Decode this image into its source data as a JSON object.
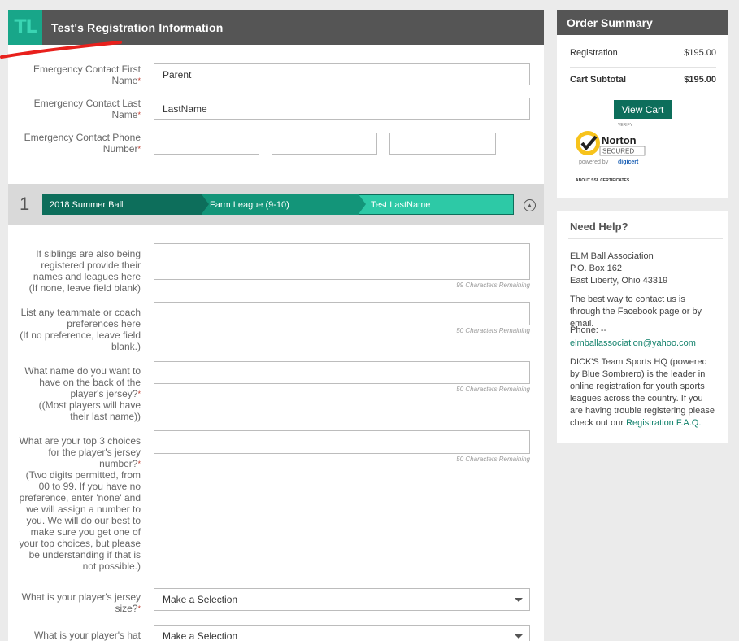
{
  "main": {
    "badge": "TL",
    "title": "Test's Registration Information"
  },
  "emergency": {
    "first_name_label": "Emergency Contact First Name",
    "first_name_value": "Parent",
    "last_name_label": "Emergency Contact Last Name",
    "last_name_value": "LastName",
    "phone_label": "Emergency Contact Phone Number"
  },
  "progress": {
    "number": "1",
    "steps": [
      "2018 Summer Ball",
      "Farm League (9-10)",
      "Test LastName"
    ]
  },
  "questions": {
    "siblings_label_1": "If siblings are also being registered provide their names and leagues here",
    "siblings_label_2": "(If none, leave field blank)",
    "siblings_chars": "99 Characters Remaining",
    "teammate_label_1": "List any teammate or coach preferences here",
    "teammate_label_2": "(If no preference, leave field blank.)",
    "teammate_chars": "50 Characters Remaining",
    "jersey_name_label_1": "What name do you want to have on the back of the player's jersey?",
    "jersey_name_label_2": "((Most players will have their last name))",
    "jersey_name_chars": "50 Characters Remaining",
    "jersey_number_label_1": "What are your top 3 choices for the player's jersey number?",
    "jersey_number_label_2": "(Two digits permitted, from 00 to 99. If you have no preference, enter 'none' and we will assign a number to you. We will do our best to make sure you get one of your top choices, but please be understanding if that is not possible.)",
    "jersey_number_chars": "50 Characters Remaining",
    "jersey_size_label": "What is your player's jersey size?",
    "jersey_size_value": "Make a Selection",
    "hat_label": "What is your player's hat",
    "hat_value": "Make a Selection"
  },
  "order": {
    "title": "Order Summary",
    "registration_label": "Registration",
    "registration_amount": "$195.00",
    "subtotal_label": "Cart Subtotal",
    "subtotal_amount": "$195.00",
    "view_cart": "View Cart",
    "norton_verify": "VERIFY",
    "norton_name": "Norton",
    "norton_secured": "SECURED",
    "norton_powered": "powered by",
    "norton_digicert": "digicert",
    "norton_about": "ABOUT SSL CERTIFICATES"
  },
  "help": {
    "title": "Need Help?",
    "org": "ELM Ball Association",
    "address1": "P.O. Box 162",
    "address2": "East Liberty, Ohio 43319",
    "contact_note": "The best way to contact us is through the Facebook page or by email.",
    "phone": "Phone: --",
    "email": "elmballassociation@yahoo.com",
    "about_text": "DICK'S Team Sports HQ (powered by Blue Sombrero) is the leader in online registration for youth sports leagues across the country. If you are having trouble registering please check out our",
    "faq_link": "Registration F.A.Q."
  },
  "colors": {
    "header_gray": "#555555",
    "brand_green": "#0d6e5b",
    "accent_teal": "#2dc9a6",
    "required_red": "#c0392b"
  }
}
